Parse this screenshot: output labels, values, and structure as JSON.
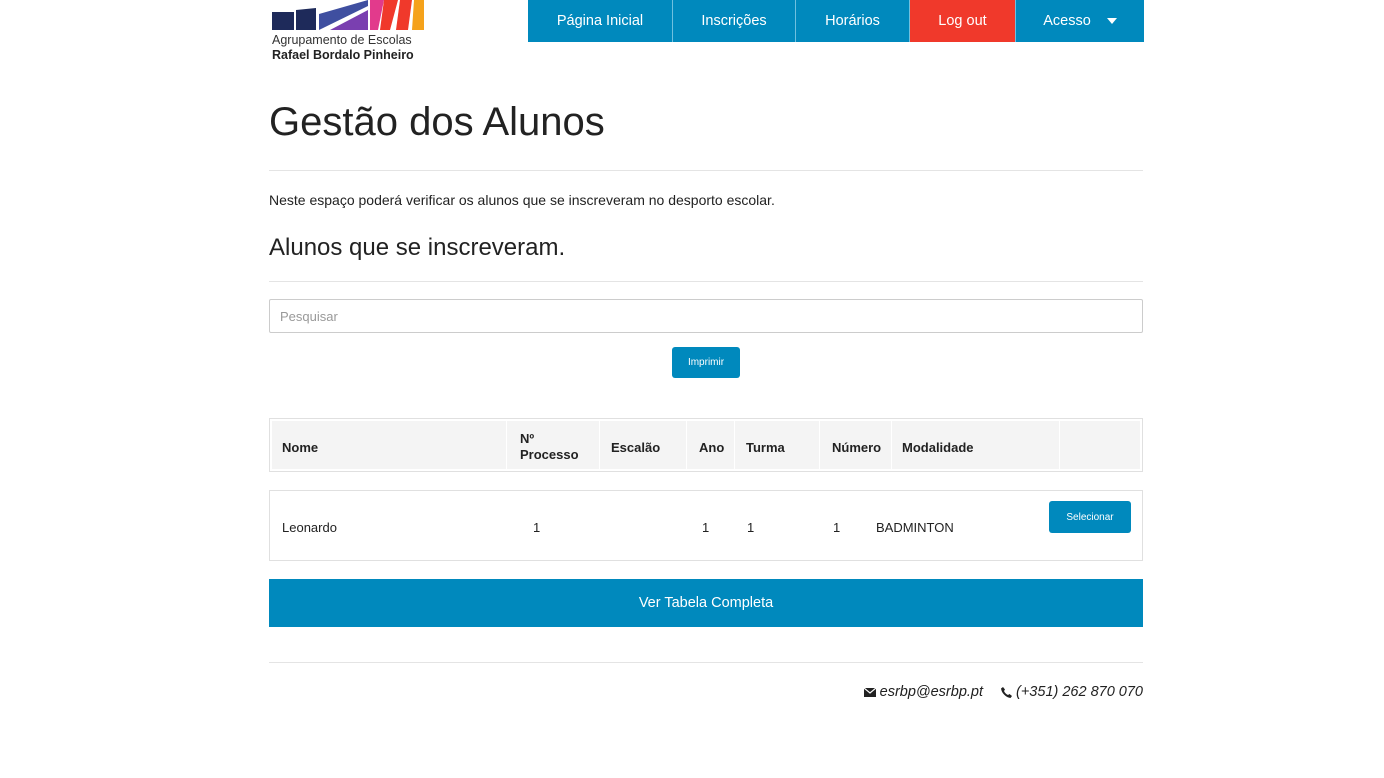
{
  "logo": {
    "line1": "Agrupamento de Escolas",
    "line2": "Rafael Bordalo Pinheiro",
    "colors": [
      "#1e2a5a",
      "#3f4fa0",
      "#7a3fb0",
      "#e23a8c",
      "#f0392b",
      "#f5a21b"
    ]
  },
  "nav": {
    "items": [
      {
        "label": "Página Inicial"
      },
      {
        "label": "Inscrições"
      },
      {
        "label": "Horários"
      },
      {
        "label": "Log out"
      },
      {
        "label": "Acesso"
      }
    ]
  },
  "page": {
    "title": "Gestão dos Alunos",
    "intro": "Neste espaço poderá verificar os alunos que se inscreveram no desporto escolar.",
    "subtitle": "Alunos que se inscreveram."
  },
  "search": {
    "placeholder": "Pesquisar",
    "value": ""
  },
  "print_button": "Imprimir",
  "table": {
    "headers": {
      "nome": "Nome",
      "processo_line1": "Nº",
      "processo_line2": "Processo",
      "escalao": "Escalão",
      "ano": "Ano",
      "turma": "Turma",
      "numero": "Número",
      "modalidade": "Modalidade"
    },
    "rows": [
      {
        "nome": "Leonardo",
        "processo": "1",
        "escalao": "",
        "ano": "1",
        "turma": "1",
        "numero": "1",
        "modalidade": "BADMINTON",
        "action": "Selecionar"
      }
    ]
  },
  "full_table_button": "Ver Tabela Completa",
  "footer": {
    "email": "esrbp@esrbp.pt",
    "phone": "(+351) 262 870 070"
  },
  "colors": {
    "primary": "#0089bd",
    "logout": "#f0392b"
  }
}
